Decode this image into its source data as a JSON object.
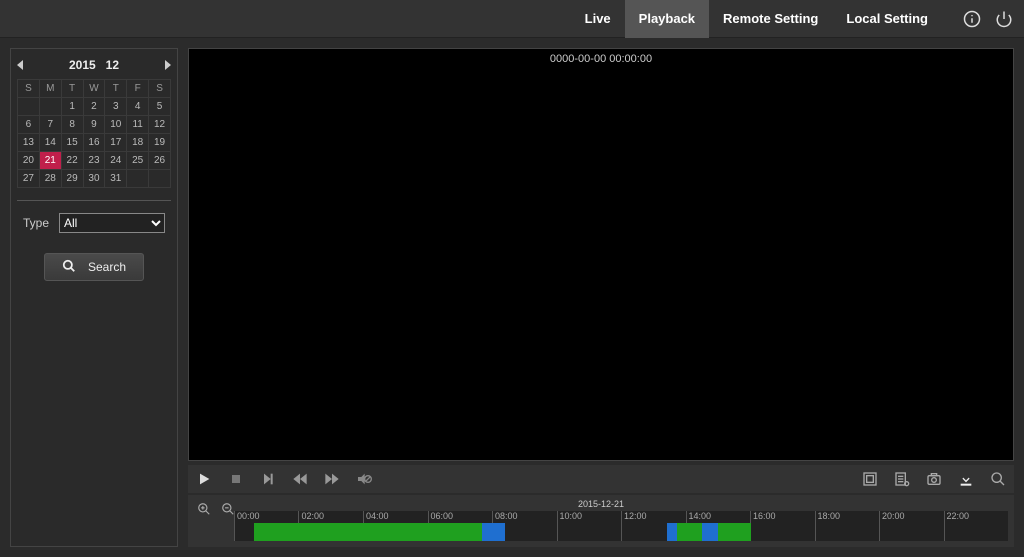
{
  "nav": {
    "live": "Live",
    "playback": "Playback",
    "remote_setting": "Remote Setting",
    "local_setting": "Local Setting"
  },
  "calendar": {
    "year": "2015",
    "month": "12",
    "weekdays": [
      "S",
      "M",
      "T",
      "W",
      "T",
      "F",
      "S"
    ],
    "days": [
      [
        "",
        "",
        "1",
        "2",
        "3",
        "4",
        "5"
      ],
      [
        "6",
        "7",
        "8",
        "9",
        "10",
        "11",
        "12"
      ],
      [
        "13",
        "14",
        "15",
        "16",
        "17",
        "18",
        "19"
      ],
      [
        "20",
        "21",
        "22",
        "23",
        "24",
        "25",
        "26"
      ],
      [
        "27",
        "28",
        "29",
        "30",
        "31",
        "",
        ""
      ]
    ],
    "selected": "21"
  },
  "type": {
    "label": "Type",
    "selected": "All"
  },
  "search_label": "Search",
  "video": {
    "timestamp": "0000-00-00 00:00:00"
  },
  "timeline": {
    "date": "2015-12-21",
    "hours": [
      "00:00",
      "02:00",
      "04:00",
      "06:00",
      "08:00",
      "10:00",
      "12:00",
      "14:00",
      "16:00",
      "18:00",
      "20:00",
      "22:00"
    ],
    "segments": [
      {
        "start_pct": 2.6,
        "end_pct": 32.0,
        "color": "green"
      },
      {
        "start_pct": 32.0,
        "end_pct": 35.0,
        "color": "blue"
      },
      {
        "start_pct": 56.0,
        "end_pct": 57.2,
        "color": "blue"
      },
      {
        "start_pct": 57.2,
        "end_pct": 60.5,
        "color": "green"
      },
      {
        "start_pct": 60.5,
        "end_pct": 62.5,
        "color": "blue"
      },
      {
        "start_pct": 62.5,
        "end_pct": 66.8,
        "color": "green"
      }
    ]
  }
}
